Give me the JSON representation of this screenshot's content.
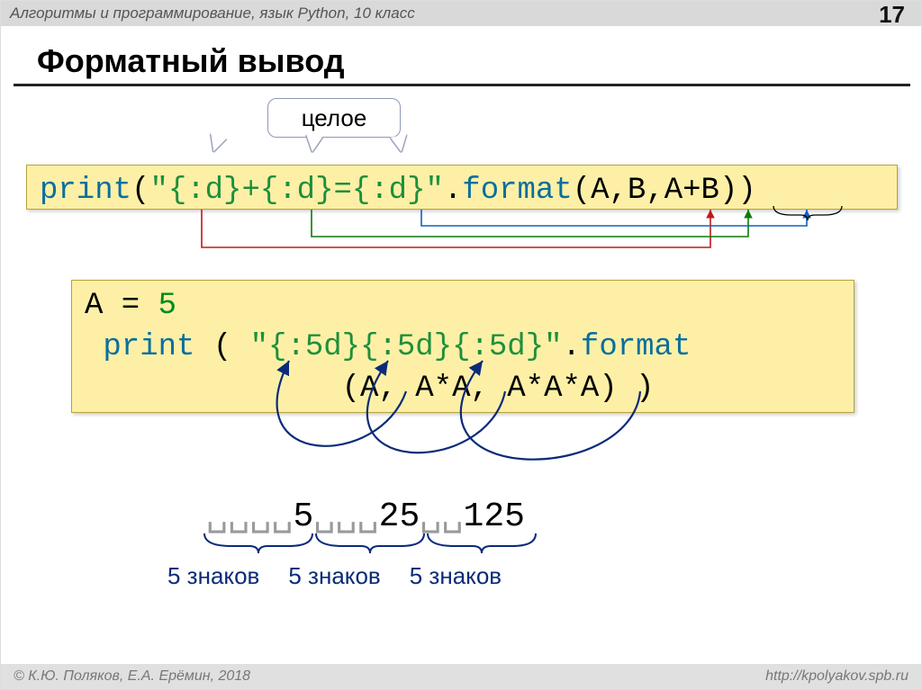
{
  "header": {
    "subject": "Алгоритмы и программирование, язык Python, 10 класс",
    "page": "17"
  },
  "title": "Форматный вывод",
  "callout": "целое",
  "code1": {
    "fn": "print",
    "open": "(",
    "str": "\"{:d}+{:d}={:d}\"",
    "dot": ".",
    "meth": "format",
    "args": "(A,B,A+B))"
  },
  "code2": {
    "line1_lhs": "A = ",
    "line1_num": "5",
    "line2_fn": "print",
    "line2_open": " ( ",
    "line2_str": "\"{:5d}{:5d}{:5d}\"",
    "line2_dot": ".",
    "line2_meth": "format",
    "line3_args": "              (A, A*A, A*A*A) )"
  },
  "output": {
    "seg1_pad": "␣␣␣␣",
    "seg1_val": "5",
    "seg2_pad": "␣␣␣",
    "seg2_val": "25",
    "seg3_pad": "␣␣",
    "seg3_val": "125"
  },
  "labels": {
    "five_chars": "5 знаков"
  },
  "footer": {
    "copyright": "© К.Ю. Поляков, Е.А. Ерёмин, 2018",
    "url": "http://kpolyakov.spb.ru"
  }
}
